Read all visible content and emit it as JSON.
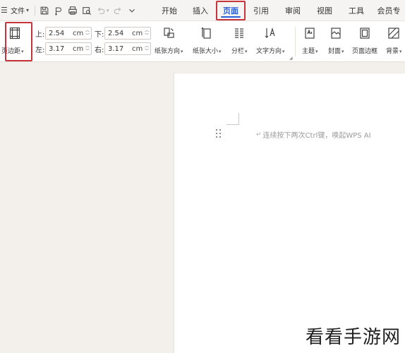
{
  "menubar": {
    "file_label": "文件",
    "tabs": [
      {
        "label": "开始"
      },
      {
        "label": "插入"
      },
      {
        "label": "页面",
        "active": true
      },
      {
        "label": "引用"
      },
      {
        "label": "审阅"
      },
      {
        "label": "视图"
      },
      {
        "label": "工具"
      },
      {
        "label": "会员专"
      }
    ],
    "accent_color": "#2b5fd9",
    "highlight_color": "#c8343b"
  },
  "ribbon": {
    "margins_label": "页边距",
    "top_label": "上:",
    "top_value": "2.54",
    "bottom_label": "下:",
    "bottom_value": "2.54",
    "left_label": "左:",
    "left_value": "3.17",
    "right_label": "右:",
    "right_value": "3.17",
    "unit": "cm",
    "orientation_label": "纸张方向",
    "size_label": "纸张大小",
    "columns_label": "分栏",
    "text_direction_label": "文字方向",
    "theme_label": "主题",
    "cover_label": "封面",
    "border_label": "页面边框",
    "background_label": "背景"
  },
  "document": {
    "hint_text": "连续按下两次Ctrl键，唤起WPS AI"
  },
  "watermark": "看看手游网"
}
